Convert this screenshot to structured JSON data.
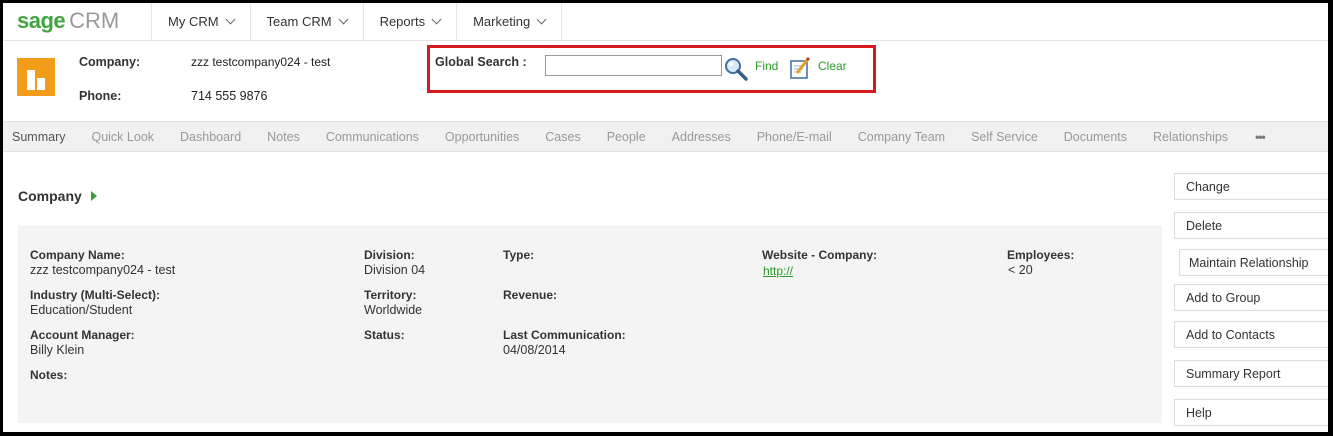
{
  "brand": {
    "sage": "sage",
    "crm": "CRM"
  },
  "menu": [
    {
      "label": "My CRM"
    },
    {
      "label": "Team CRM"
    },
    {
      "label": "Reports"
    },
    {
      "label": "Marketing"
    }
  ],
  "header": {
    "company_label": "Company:",
    "company_value": "zzz testcompany024 - test",
    "phone_label": "Phone:",
    "phone_value": "714 555 9876"
  },
  "global_search": {
    "label": "Global Search :",
    "value": "",
    "find_label": "Find",
    "clear_label": "Clear"
  },
  "tabs": [
    "Summary",
    "Quick Look",
    "Dashboard",
    "Notes",
    "Communications",
    "Opportunities",
    "Cases",
    "People",
    "Addresses",
    "Phone/E-mail",
    "Company Team",
    "Self Service",
    "Documents",
    "Relationships"
  ],
  "tabs_more": "•••",
  "section": {
    "title": "Company"
  },
  "fields": {
    "company_name_label": "Company Name:",
    "company_name_value": "zzz testcompany024 - test",
    "industry_label": "Industry (Multi-Select):",
    "industry_value": "Education/Student",
    "account_manager_label": "Account Manager:",
    "account_manager_value": "Billy Klein",
    "notes_label": "Notes:",
    "division_label": "Division:",
    "division_value": "Division 04",
    "territory_label": "Territory:",
    "territory_value": "Worldwide",
    "status_label": "Status:",
    "type_label": "Type:",
    "revenue_label": "Revenue:",
    "last_comm_label": "Last Communication:",
    "last_comm_value": "04/08/2014",
    "website_label": "Website - Company:",
    "website_value": "http://",
    "employees_label": "Employees:",
    "employees_value": "< 20"
  },
  "actions": [
    "Change",
    "Delete",
    "Maintain Relationship",
    "Add to Group",
    "Add to Contacts",
    "Summary Report",
    "Help"
  ],
  "colors": {
    "brand_green": "#41a63f",
    "link_green": "#2a9a2a",
    "highlight_red": "#d71920",
    "entity_orange": "#f39c1a"
  }
}
